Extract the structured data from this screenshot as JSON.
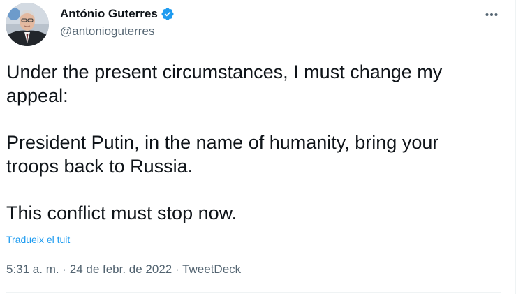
{
  "author": {
    "display_name": "António Guterres",
    "handle": "@antonioguterres",
    "verified": true,
    "avatar_icon": "profile-photo"
  },
  "tweet": {
    "paragraphs": [
      "Under the present circumstances, I must change my appeal:",
      "President Putin, in the name of humanity, bring your troops back to Russia.",
      "This conflict must stop now."
    ],
    "translate_label": "Tradueix el tuit"
  },
  "meta": {
    "time": "5:31 a. m.",
    "separator": "·",
    "date": "24 de febr. de 2022",
    "source": "TweetDeck"
  },
  "icons": {
    "verified": "verified-badge-icon",
    "more": "more-options-icon"
  },
  "colors": {
    "accent": "#1d9bf0",
    "text_primary": "#0f1419",
    "text_secondary": "#536471"
  }
}
